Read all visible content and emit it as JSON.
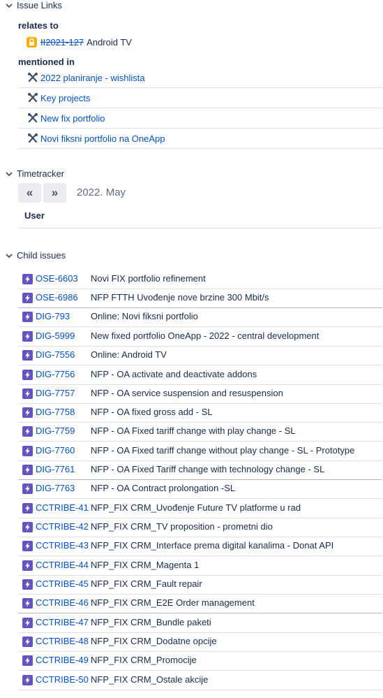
{
  "issue_links": {
    "title": "Issue Links",
    "relates_to": {
      "label": "relates to",
      "item": {
        "key": "II2021-127",
        "summary": "Android TV"
      }
    },
    "mentioned_in": {
      "label": "mentioned in",
      "items": [
        "2022 planiranje - wishlista",
        "Key projects",
        "New fix portfolio",
        "Novi fiksni portfolio na OneApp"
      ]
    }
  },
  "timetracker": {
    "title": "Timetracker",
    "prev_label": "«",
    "next_label": "»",
    "period": "2022. May",
    "column_user": "User"
  },
  "child_issues": {
    "title": "Child issues",
    "items": [
      {
        "key": "OSE-6603",
        "summary": "Novi FIX portfolio refinement"
      },
      {
        "key": "OSE-6986",
        "summary": "NFP FTTH Uvođenje nove brzine 300 Mbit/s"
      },
      {
        "key": "DIG-793",
        "summary": "Online: Novi fiksni portfolio"
      },
      {
        "key": "DIG-5999",
        "summary": "New fixed portfolio OneApp - 2022 - central development"
      },
      {
        "key": "DIG-7556",
        "summary": "Online: Android TV"
      },
      {
        "key": "DIG-7756",
        "summary": "NFP - OA activate and deactivate addons"
      },
      {
        "key": "DIG-7757",
        "summary": "NFP - OA service suspension and resuspension"
      },
      {
        "key": "DIG-7758",
        "summary": "NFP - OA fixed gross add - SL"
      },
      {
        "key": "DIG-7759",
        "summary": "NFP - OA Fixed tariff change with play change - SL"
      },
      {
        "key": "DIG-7760",
        "summary": "NFP - OA Fixed tariff change without play change - SL - Prototype"
      },
      {
        "key": "DIG-7761",
        "summary": "NFP - OA Fixed Tariff change with technology change - SL"
      },
      {
        "key": "DIG-7763",
        "summary": "NFP - OA Contract prolongation -SL"
      },
      {
        "key": "CCTRIBE-41",
        "summary": "NFP_FIX CRM_Uvođenje Future TV platforme u rad"
      },
      {
        "key": "CCTRIBE-42",
        "summary": "NFP_FIX CRM_TV proposition - prometni dio"
      },
      {
        "key": "CCTRIBE-43",
        "summary": "NFP_FIX CRM_Interface prema digital kanalima - Donat API"
      },
      {
        "key": "CCTRIBE-44",
        "summary": "NFP_FIX CRM_Magenta 1"
      },
      {
        "key": "CCTRIBE-45",
        "summary": "NFP_FIX CRM_Fault repair"
      },
      {
        "key": "CCTRIBE-46",
        "summary": "NFP_FIX CRM_E2E Order management"
      },
      {
        "key": "CCTRIBE-47",
        "summary": "NFP_FIX CRM_Bundle paketi"
      },
      {
        "key": "CCTRIBE-48",
        "summary": "NFP_FIX CRM_Dodatne opcije"
      },
      {
        "key": "CCTRIBE-49",
        "summary": "NFP_FIX CRM_Promocije"
      },
      {
        "key": "CCTRIBE-50",
        "summary": "NFP_FIX CRM_Ostale akcije"
      }
    ]
  },
  "icons": {
    "section_toggle": "chevron-down-icon",
    "locked_issue": "lock-icon",
    "mention_page": "confluence-tools-icon",
    "child_issue_type": "epic-lightning-icon"
  },
  "colors": {
    "link": "#0052cc",
    "text": "#172b4d",
    "epic": "#6554c0",
    "lock": "#ffab00"
  }
}
